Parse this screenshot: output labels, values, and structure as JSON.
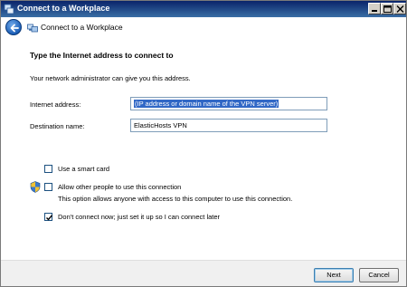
{
  "window": {
    "title": "Connect to a Workplace",
    "controls": {
      "minimize": "minimize",
      "maximize": "maximize",
      "close": "close"
    }
  },
  "header": {
    "title": "Connect to a Workplace",
    "back_icon": "back-arrow-icon",
    "page_icon": "workplace-network-icon"
  },
  "content": {
    "heading": "Type the Internet address to connect to",
    "subtext": "Your network administrator can give you this address.",
    "internet_address": {
      "label": "Internet address:",
      "value": "(IP address or domain name of the VPN server)"
    },
    "destination_name": {
      "label": "Destination name:",
      "value": "ElasticHosts VPN"
    },
    "options": {
      "smart_card": {
        "label": "Use a smart card",
        "checked": false
      },
      "allow_others": {
        "label": "Allow other people to use this connection",
        "note": "This option allows anyone with access to this computer to use this connection.",
        "checked": false
      },
      "dont_connect": {
        "label": "Don't connect now; just set it up so I can connect later",
        "checked": true
      }
    }
  },
  "footer": {
    "next_label": "Next",
    "cancel_label": "Cancel"
  },
  "colors": {
    "title_bar": "#0a246a",
    "selection": "#3168c6",
    "input_border": "#7f9db9"
  }
}
